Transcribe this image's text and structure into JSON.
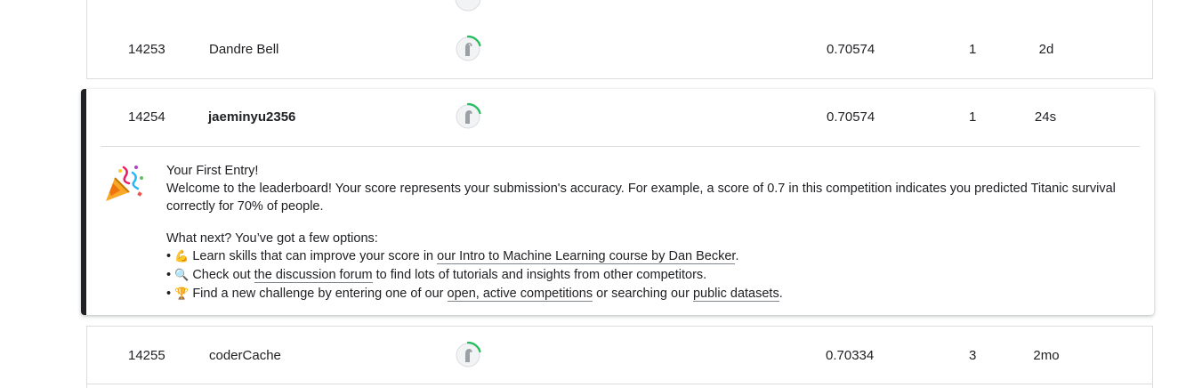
{
  "rows": [
    {
      "rank": "14253",
      "name": "Dandre Bell",
      "score": "0.70574",
      "entries": "1",
      "last": "2d"
    },
    {
      "rank": "14254",
      "name": "jaeminyu2356",
      "score": "0.70574",
      "entries": "1",
      "last": "24s"
    },
    {
      "rank": "14255",
      "name": "coderCache",
      "score": "0.70334",
      "entries": "3",
      "last": "2mo"
    }
  ],
  "message": {
    "title": "Your First Entry!",
    "welcome": "Welcome to the leaderboard! Your score represents your submission's accuracy. For example, a score of 0.7 in this competition indicates you predicted Titanic survival correctly for 70% of people.",
    "next_heading": "What next? You’ve got a few options:",
    "bullet": "•",
    "item1": {
      "emoji": "💪",
      "before": " Learn skills that can improve your score in ",
      "link": "our Intro to Machine Learning course by Dan Becker",
      "after": "."
    },
    "item2": {
      "emoji": "🔍",
      "before": " Check out ",
      "link": "the discussion forum",
      "after": " to find lots of tutorials and insights from other competitors."
    },
    "item3": {
      "emoji": "🏆",
      "before": " Find a new challenge by entering one of our ",
      "link": "open, active competitions",
      "middle": " or searching our ",
      "link2": "public datasets",
      "after": "."
    }
  },
  "colors": {
    "progress_arc": "#20be5a",
    "card_border": "#202124",
    "divider": "#dadce0"
  },
  "icons": {
    "avatar": "default-avatar-icon",
    "celebration": "party-popper-icon"
  }
}
